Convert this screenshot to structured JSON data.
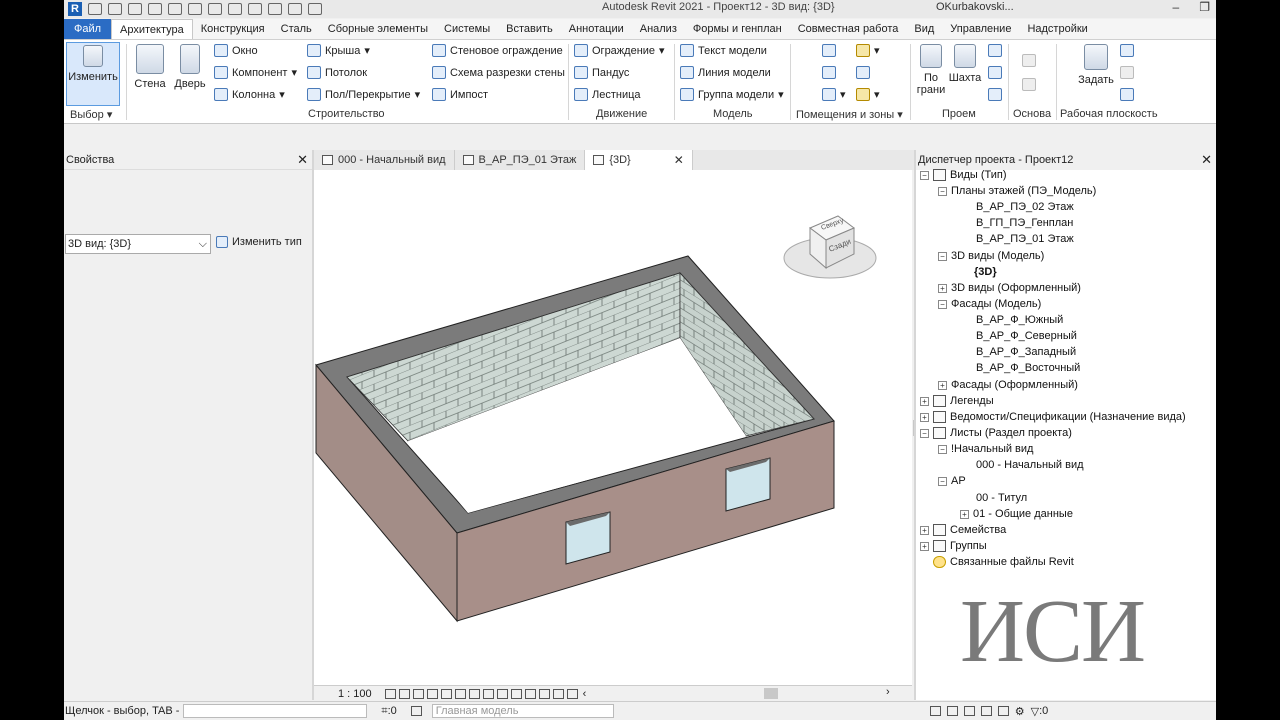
{
  "titlebar": {
    "title": "Autodesk Revit 2021 - Проект12 - 3D вид: {3D}",
    "user": "OKurbakovski..."
  },
  "menu": [
    "Файл",
    "Архитектура",
    "Конструкция",
    "Сталь",
    "Сборные элементы",
    "Системы",
    "Вставить",
    "Аннотации",
    "Анализ",
    "Формы и генплан",
    "Совместная работа",
    "Вид",
    "Управление",
    "Надстройки"
  ],
  "ribbon": {
    "modify": "Изменить",
    "select_panel": "Выбор",
    "wall": "Стена",
    "door": "Дверь",
    "window": "Окно",
    "component": "Компонент",
    "column": "Колонна",
    "roof": "Крыша",
    "ceiling": "Потолок",
    "floor": "Пол/Перекрытие",
    "curtain_system": "Стеновое ограждение",
    "curtain_grid": "Схема разрезки стены",
    "mullion": "Импост",
    "build_panel": "Строительство",
    "railing": "Ограждение",
    "ramp": "Пандус",
    "stair": "Лестница",
    "circulation_panel": "Движение",
    "model_text": "Текст модели",
    "model_line": "Линия  модели",
    "model_group": "Группа модели",
    "model_panel": "Модель",
    "rooms_panel": "Помещения и зоны",
    "by_face_1": "По",
    "by_face_2": "грани",
    "shaft": "Шахта",
    "opening_panel": "Проем",
    "datum_panel": "Основа",
    "set": "Задать",
    "workplane_panel": "Рабочая плоскость"
  },
  "properties": {
    "title": "Свойства",
    "type": "3D вид: {3D}",
    "edit_type": "Изменить тип"
  },
  "tabs": [
    {
      "label": "000 - Начальный вид"
    },
    {
      "label": "В_АР_ПЭ_01 Этаж"
    },
    {
      "label": "{3D}"
    }
  ],
  "viewcube": {
    "face_top": "Сверху",
    "face_front": "Сзади"
  },
  "viewbar": {
    "scale": "1 : 100"
  },
  "browser": {
    "title": "Диспетчер проекта - Проект12",
    "nodes": [
      {
        "label": "Виды (Тип)"
      },
      {
        "label": "Планы этажей (ПЭ_Модель)"
      },
      {
        "label": "В_АР_ПЭ_02 Этаж"
      },
      {
        "label": "В_ГП_ПЭ_Генплан"
      },
      {
        "label": "В_АР_ПЭ_01 Этаж"
      },
      {
        "label": "3D виды (Модель)"
      },
      {
        "label": "{3D}"
      },
      {
        "label": "3D виды (Оформленный)"
      },
      {
        "label": "Фасады (Модель)"
      },
      {
        "label": "В_АР_Ф_Южный"
      },
      {
        "label": "В_АР_Ф_Северный"
      },
      {
        "label": "В_АР_Ф_Западный"
      },
      {
        "label": "В_АР_Ф_Восточный"
      },
      {
        "label": "Фасады (Оформленный)"
      },
      {
        "label": "Легенды"
      },
      {
        "label": "Ведомости/Спецификации (Назначение вида)"
      },
      {
        "label": "Листы (Раздел проекта)"
      },
      {
        "label": "!Начальный вид"
      },
      {
        "label": "000 - Начальный вид"
      },
      {
        "label": "АР"
      },
      {
        "label": "00 - Титул"
      },
      {
        "label": "01 - Общие данные"
      },
      {
        "label": "Семейства"
      },
      {
        "label": "Группы"
      },
      {
        "label": "Связанные файлы Revit"
      }
    ]
  },
  "status": {
    "hint": "Щелчок - выбор, TAB -",
    "count": ":0",
    "model": "Главная модель",
    "filter": ":0"
  },
  "watermark": "ИСИ"
}
